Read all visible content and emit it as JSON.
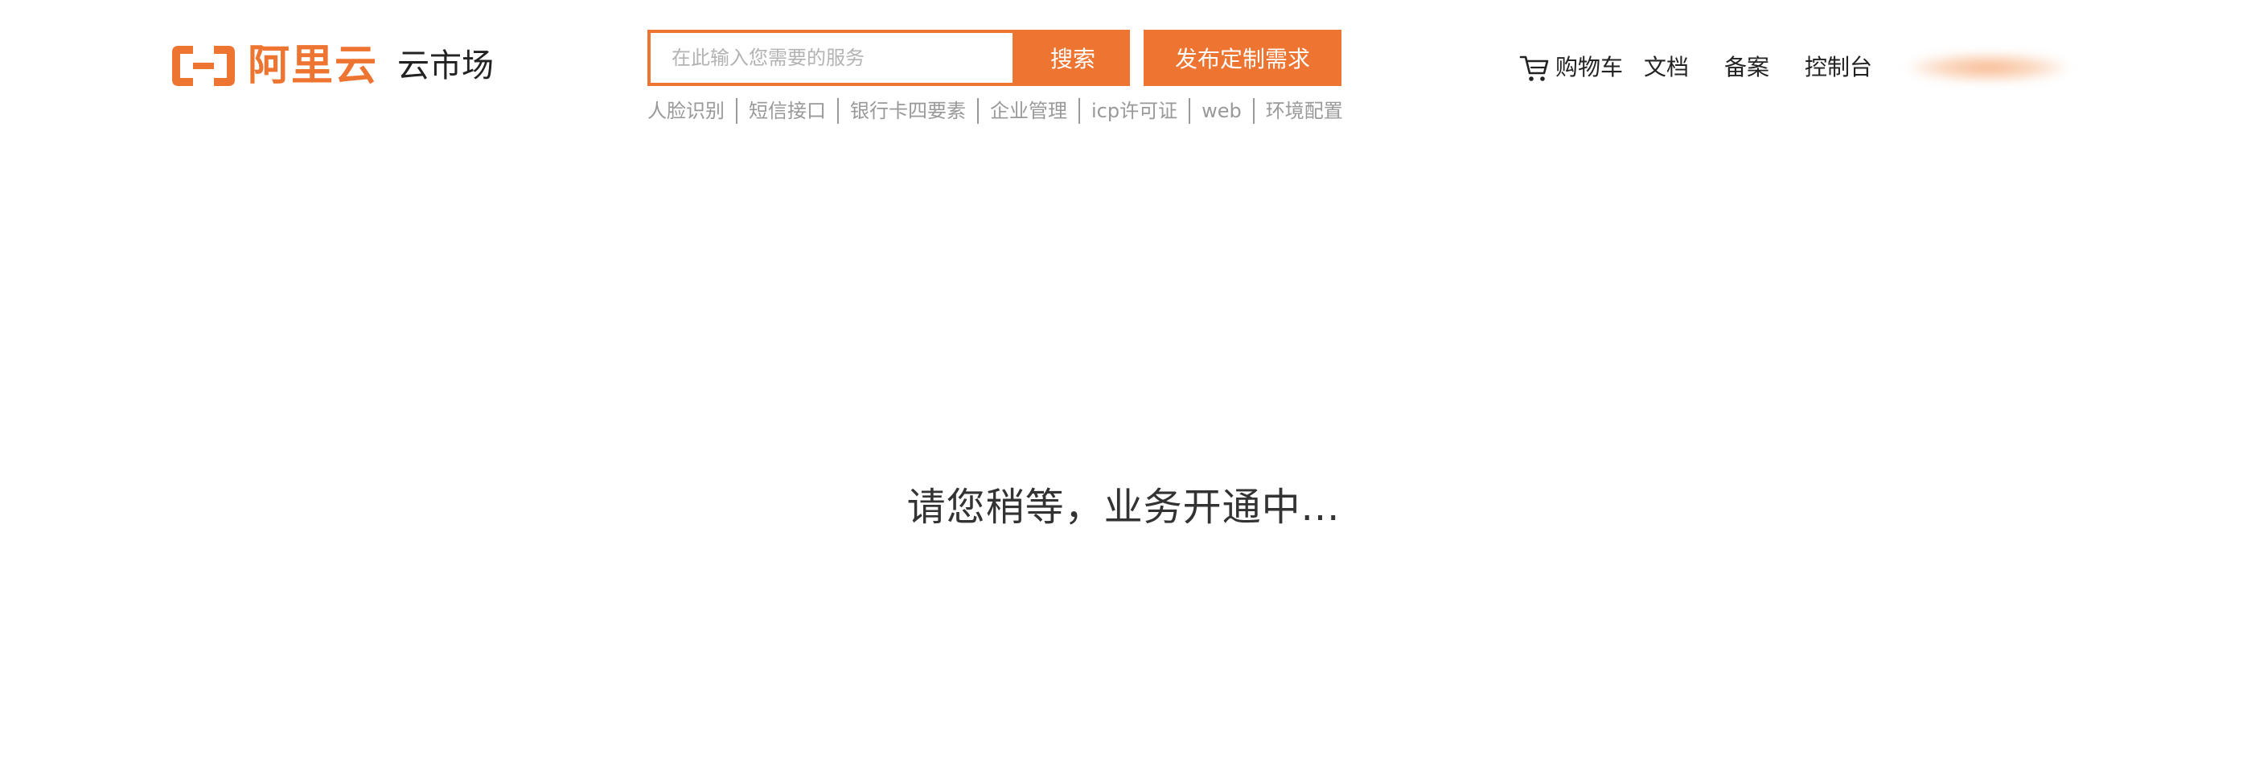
{
  "brand": {
    "logo_text": "阿里云",
    "product_name": "云市场",
    "accent_color": "#ee7431"
  },
  "search": {
    "placeholder": "在此输入您需要的服务",
    "value": "",
    "button_label": "搜索"
  },
  "publish_button_label": "发布定制需求",
  "hot_keywords": [
    "人脸识别",
    "短信接口",
    "银行卡四要素",
    "企业管理",
    "icp许可证",
    "web",
    "环境配置"
  ],
  "nav": {
    "cart_label": "购物车",
    "cart_icon": "shopping-cart-icon",
    "docs_label": "文档",
    "beian_label": "备案",
    "console_label": "控制台"
  },
  "status_message": "请您稍等，业务开通中..."
}
